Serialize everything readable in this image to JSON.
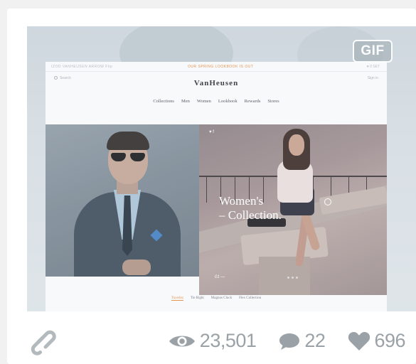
{
  "shot": {
    "badge": "GIF",
    "site": {
      "topbar_left": "IZOD  VANHEUSEN  ARROW  Flip",
      "topbar_center": "OUR SPRING LOOKBOOK IS OUT",
      "topbar_right": "♥ 0  SET",
      "search_label": "Search",
      "signin_label": "Sign in",
      "brand": "VanHeusen",
      "nav": [
        "Collections",
        "Men",
        "Women",
        "Lookbook",
        "Rewards",
        "Stores"
      ],
      "social": "♥  f",
      "headline_line1": "Women's",
      "headline_line2": "– Collection.",
      "page_number": "01 —",
      "subnav": [
        "Tuxedos",
        "Tie Right",
        "Magnus Cluck",
        "Flex Collection"
      ]
    }
  },
  "stats": {
    "views": "23,501",
    "comments": "22",
    "likes": "696"
  },
  "colors": {
    "accent": "#e8893b",
    "stat_gray": "#9aa2a7"
  }
}
